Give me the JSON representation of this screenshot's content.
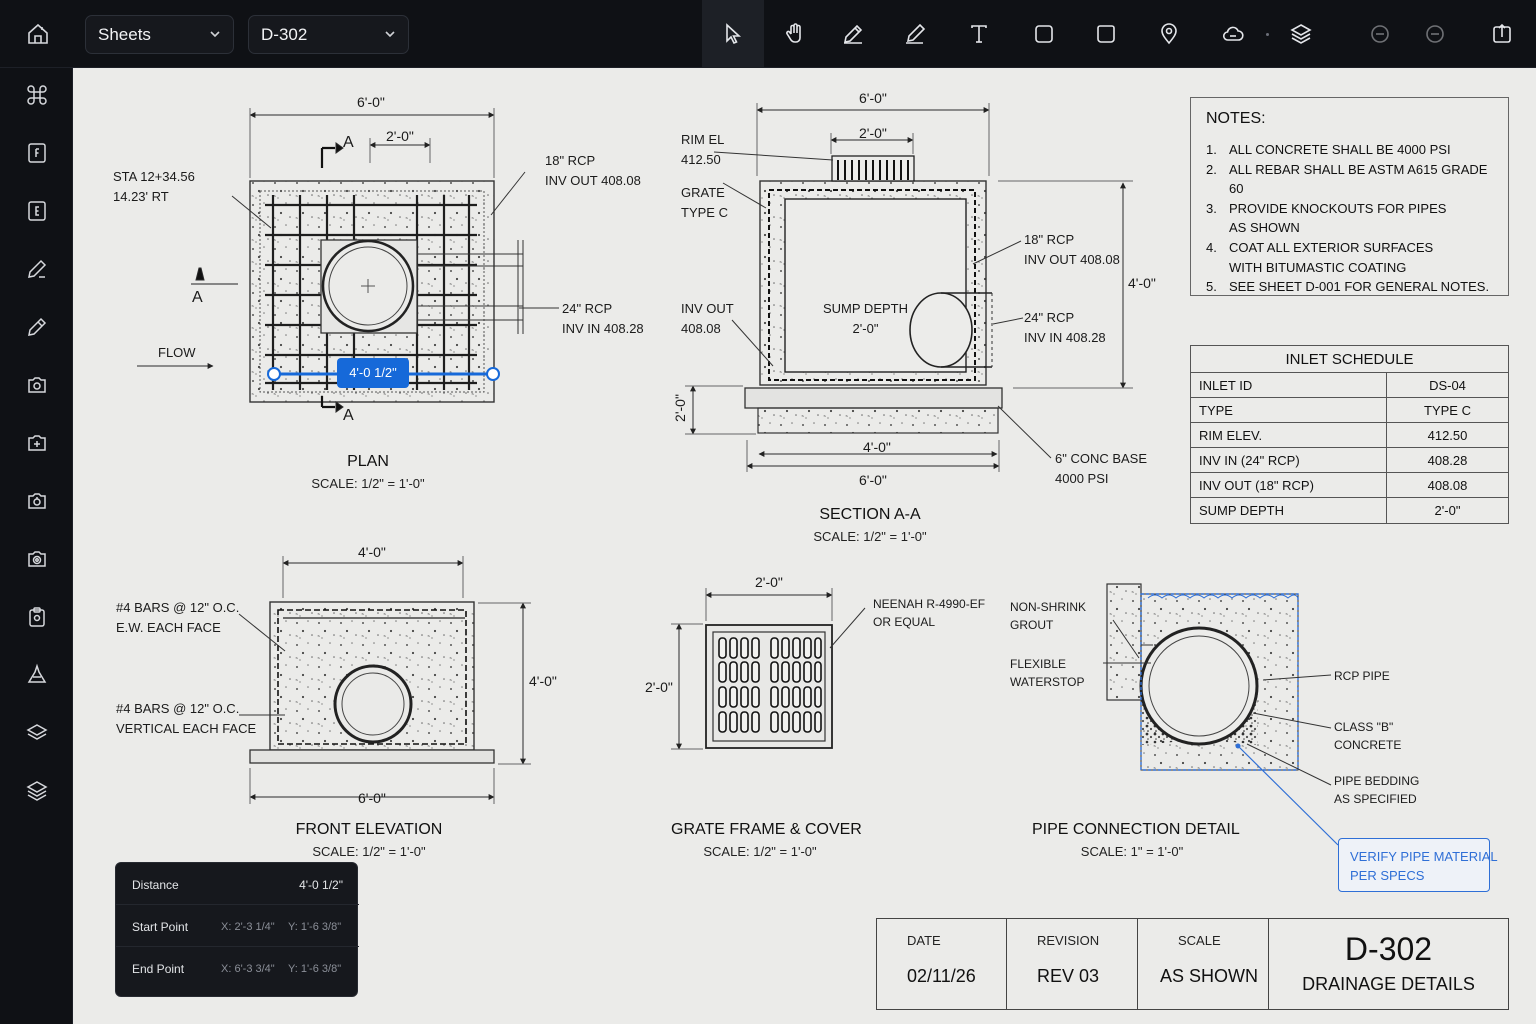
{
  "toolbar": {
    "sheets_label": "Sheets",
    "sheet_selected": "D-302",
    "tools": [
      {
        "name": "select-tool",
        "icon": "cursor-icon",
        "active": true
      },
      {
        "name": "pan-tool",
        "icon": "hand-icon"
      },
      {
        "name": "markup-tool",
        "icon": "pencil-icon"
      },
      {
        "name": "highlight-tool",
        "icon": "highlighter-icon"
      },
      {
        "name": "text-tool",
        "icon": "text-icon"
      },
      {
        "name": "rectangle-tool",
        "icon": "square-icon"
      },
      {
        "name": "cloud-shape-tool",
        "icon": "rounded-square-icon"
      },
      {
        "name": "pin-tool",
        "icon": "location-pin-icon"
      },
      {
        "name": "cloud-markup-tool",
        "icon": "cloud-icon"
      },
      {
        "name": "layers-tool",
        "icon": "layers-icon"
      },
      {
        "name": "undo-tool",
        "icon": "undo-icon"
      },
      {
        "name": "redo-tool",
        "icon": "redo-icon"
      },
      {
        "name": "export-tool",
        "icon": "export-icon"
      }
    ]
  },
  "sidebar": {
    "items": [
      "command-icon",
      "sheet-f-icon",
      "sheet-e-icon",
      "measure-pen-icon",
      "edit-pen-icon",
      "camera-a-icon",
      "camera-b-icon",
      "camera-c-icon",
      "photo-icon",
      "clipboard-icon",
      "hazard-icon",
      "layers-icon",
      "stack-icon"
    ]
  },
  "plan": {
    "dim_top": "6'-0\"",
    "dim_grate": "2'-0\"",
    "section_marker": "A",
    "station": "STA 12+34.56\n14.23' RT",
    "pipe_out": "18\" RCP\nINV OUT 408.08",
    "pipe_in": "24\" RCP\nINV IN 408.28",
    "flow": "FLOW",
    "title": "PLAN",
    "scale": "SCALE: 1/2\" = 1'-0\""
  },
  "measure": {
    "label": "4'-0 1/2\"",
    "color": "#1669d9"
  },
  "section": {
    "dim_top": "6'-0\"",
    "dim_grate": "2'-0\"",
    "rim": "RIM EL\n412.50",
    "grate": "GRATE\nTYPE C",
    "inv_out": "INV OUT\n408.08",
    "sump": "SUMP DEPTH\n2'-0\"",
    "pipe_out": "18\" RCP\nINV OUT 408.08",
    "pipe_in": "24\" RCP\nINV IN 408.28",
    "dim_height": "4'-0\"",
    "dim_base": "2'-0\"",
    "dim_inner": "4'-0\"",
    "dim_bottom": "6'-0\"",
    "base_note": "6\" CONC BASE\n4000 PSI",
    "title": "SECTION A-A",
    "scale": "SCALE: 1/2\" = 1'-0\""
  },
  "front": {
    "dim_top": "4'-0\"",
    "bars_horizontal": "#4 BARS @ 12\" O.C.\nE.W. EACH FACE",
    "bars_vertical": "#4 BARS @ 12\" O.C.\nVERTICAL EACH FACE",
    "dim_height": "4'-0\"",
    "dim_bottom": "6'-0\"",
    "title": "FRONT ELEVATION",
    "scale": "SCALE: 1/2\" = 1'-0\""
  },
  "grate": {
    "dim_top": "2'-0\"",
    "dim_side": "2'-0\"",
    "spec": "NEENAH R-4990-EF\nOR EQUAL",
    "title": "GRATE FRAME & COVER",
    "scale": "SCALE: 1/2\" = 1'-0\""
  },
  "pipe_detail": {
    "grout": "NON-SHRINK\nGROUT",
    "waterstop": "FLEXIBLE\nWATERSTOP",
    "rcp": "RCP PIPE",
    "concrete": "CLASS \"B\"\nCONCRETE",
    "bedding": "PIPE BEDDING\nAS SPECIFIED",
    "callout": "VERIFY PIPE MATERIAL\nPER SPECS",
    "title": "PIPE CONNECTION DETAIL",
    "scale": "SCALE: 1\" = 1'-0\""
  },
  "notes": {
    "heading": "NOTES:",
    "items": [
      {
        "n": "1.",
        "text": "ALL CONCRETE SHALL BE 4000 PSI"
      },
      {
        "n": "2.",
        "text": "ALL REBAR SHALL BE ASTM A615 GRADE 60"
      },
      {
        "n": "3.",
        "text": "PROVIDE KNOCKOUTS FOR PIPES\nAS SHOWN"
      },
      {
        "n": "4.",
        "text": "COAT ALL EXTERIOR SURFACES\nWITH BITUMASTIC COATING"
      },
      {
        "n": "5.",
        "text": "SEE SHEET D-001 FOR GENERAL NOTES."
      }
    ]
  },
  "schedule": {
    "heading": "INLET SCHEDULE",
    "rows": [
      {
        "k": "INLET ID",
        "v": "DS-04"
      },
      {
        "k": "TYPE",
        "v": "TYPE C"
      },
      {
        "k": "RIM ELEV.",
        "v": "412.50"
      },
      {
        "k": "INV IN (24\" RCP)",
        "v": "408.28"
      },
      {
        "k": "INV OUT (18\" RCP)",
        "v": "408.08"
      },
      {
        "k": "SUMP DEPTH",
        "v": "2'-0\""
      }
    ]
  },
  "titleblock": {
    "date_label": "DATE",
    "date": "02/11/26",
    "revision_label": "REVISION",
    "revision": "REV 03",
    "scale_label": "SCALE",
    "scale": "AS SHOWN",
    "sheet_number": "D-302",
    "sheet_name": "DRAINAGE DETAILS"
  },
  "measure_panel": {
    "distance_label": "Distance",
    "distance": "4'-0 1/2\"",
    "start_label": "Start Point",
    "start_x": "X: 2'-3 1/4\"",
    "start_y": "Y: 1'-6 3/8\"",
    "end_label": "End Point",
    "end_x": "X: 6'-3 3/4\"",
    "end_y": "Y: 1'-6 3/8\""
  }
}
